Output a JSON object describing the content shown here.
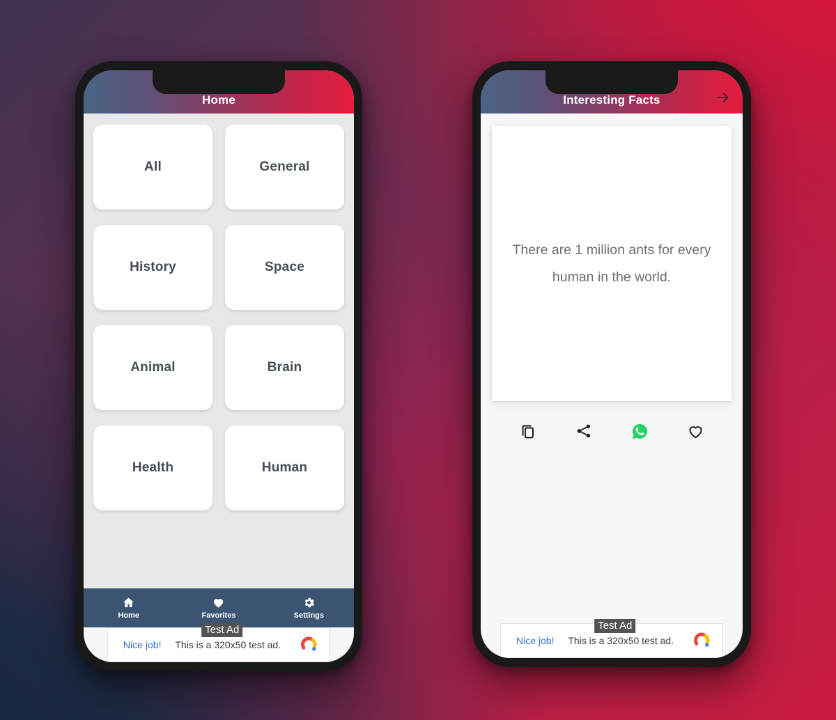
{
  "background": {
    "gradient_start": "#1d2a44",
    "gradient_mid": "#8d2450",
    "gradient_end": "#c81c40"
  },
  "theme": {
    "appbar_gradient_start": "#4a6485",
    "appbar_gradient_end": "#e41d3e",
    "navbar_color": "#3b5472",
    "tile_bg": "#ffffff",
    "grid_bg": "#e8e8e8",
    "tile_text": "#454d57",
    "fact_text": "#6e6e6e",
    "whatsapp_green": "#25d366",
    "ad_cta_color": "#2f6fd0"
  },
  "home_phone": {
    "appbar": {
      "title": "Home"
    },
    "categories": [
      {
        "label": "All"
      },
      {
        "label": "General"
      },
      {
        "label": "History"
      },
      {
        "label": "Space"
      },
      {
        "label": "Animal"
      },
      {
        "label": "Brain"
      },
      {
        "label": "Health"
      },
      {
        "label": "Human"
      }
    ],
    "bottom_nav": [
      {
        "icon": "home-icon",
        "label": "Home"
      },
      {
        "icon": "heart-icon",
        "label": "Favorites"
      },
      {
        "icon": "gear-icon",
        "label": "Settings"
      }
    ],
    "ad": {
      "badge": "Test Ad",
      "cta": "Nice job!",
      "text": "This is a 320x50 test ad.",
      "logo": "admob-logo"
    }
  },
  "fact_phone": {
    "appbar": {
      "title": "Interesting Facts",
      "action_icon": "arrow-right-icon"
    },
    "fact": {
      "text": "There are 1 million ants for every human in the world."
    },
    "actions": [
      {
        "icon": "copy-icon",
        "label": "Copy"
      },
      {
        "icon": "share-icon",
        "label": "Share"
      },
      {
        "icon": "whatsapp-icon",
        "label": "WhatsApp"
      },
      {
        "icon": "heart-outline-icon",
        "label": "Favorite"
      }
    ],
    "ad": {
      "badge": "Test Ad",
      "cta": "Nice job!",
      "text": "This is a 320x50 test ad.",
      "logo": "admob-logo"
    }
  }
}
